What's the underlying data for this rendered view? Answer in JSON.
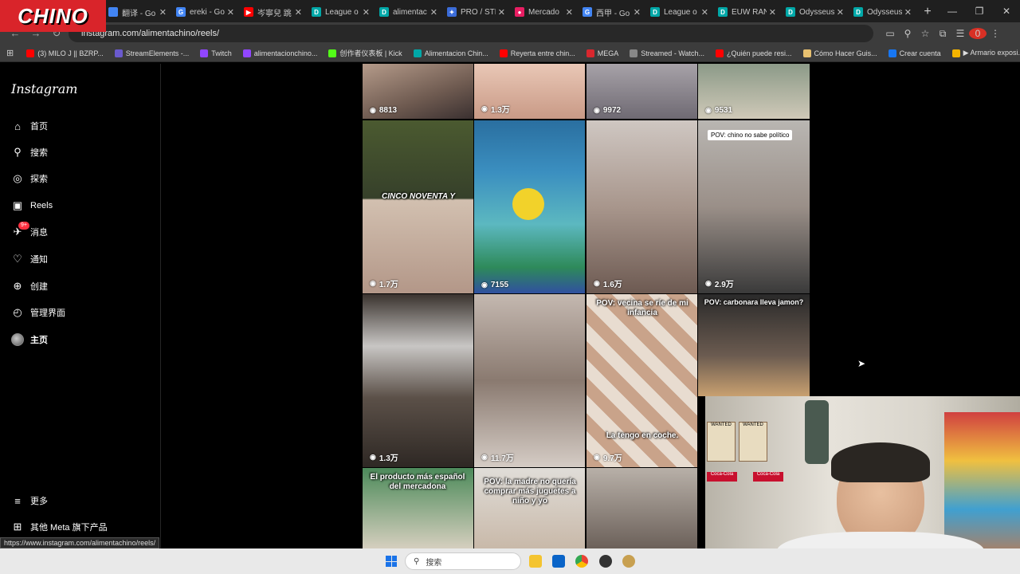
{
  "logo_overlay": "CHINO",
  "tabs": [
    {
      "title": "翻译 - Go",
      "color": "#4285f4",
      "glyph": ""
    },
    {
      "title": "ereki - Go",
      "color": "#4285f4",
      "glyph": "G"
    },
    {
      "title": "岑寧兒 跳",
      "color": "#ff0000",
      "glyph": "▶"
    },
    {
      "title": "League o",
      "color": "#00a8a8",
      "glyph": "D"
    },
    {
      "title": "alimentac",
      "color": "#00a8a8",
      "glyph": "D"
    },
    {
      "title": "PRO / STR",
      "color": "#3b6cd9",
      "glyph": "✦"
    },
    {
      "title": "Mercado",
      "color": "#e91e63",
      "glyph": "●"
    },
    {
      "title": "西甲 - Go",
      "color": "#4285f4",
      "glyph": "G"
    },
    {
      "title": "League o",
      "color": "#00a8a8",
      "glyph": "D"
    },
    {
      "title": "EUW RAN",
      "color": "#00a8a8",
      "glyph": "D"
    },
    {
      "title": "Odysseus",
      "color": "#00a8a8",
      "glyph": "D"
    },
    {
      "title": "Odysseus",
      "color": "#00a8a8",
      "glyph": "D"
    }
  ],
  "address": {
    "url": "instagram.com/alimentachino/reels/",
    "profile_badge": "0"
  },
  "bookmarks": [
    {
      "label": "(3) MILO J || BZRP...",
      "color": "#ff0000"
    },
    {
      "label": "StreamElements -...",
      "color": "#6a5acd"
    },
    {
      "label": "Twitch",
      "color": "#9146ff"
    },
    {
      "label": "alimentacionchino...",
      "color": "#9146ff"
    },
    {
      "label": "创作者仪表板 | Kick",
      "color": "#53fc18"
    },
    {
      "label": "Alimentacion Chin...",
      "color": "#00a8a8"
    },
    {
      "label": "Reyerta entre chin...",
      "color": "#ff0000"
    },
    {
      "label": "MEGA",
      "color": "#d9272e"
    },
    {
      "label": "Streamed - Watch...",
      "color": "#888888"
    },
    {
      "label": "¿Quién puede resi...",
      "color": "#ff0000"
    },
    {
      "label": "Cómo Hacer Guis...",
      "color": "#e8c170"
    },
    {
      "label": "Crear cuenta",
      "color": "#1877f2"
    },
    {
      "label": "▶ Armario exposi...",
      "color": "#f4b400"
    }
  ],
  "sidebar": {
    "brand": "Instagram",
    "items": [
      {
        "label": "首页",
        "icon": "home-icon",
        "glyph": "⌂"
      },
      {
        "label": "搜索",
        "icon": "search-icon",
        "glyph": "⚲"
      },
      {
        "label": "探索",
        "icon": "compass-icon",
        "glyph": "◎"
      },
      {
        "label": "Reels",
        "icon": "reels-icon",
        "glyph": "▣"
      },
      {
        "label": "消息",
        "icon": "messages-icon",
        "glyph": "✈",
        "badge": "9+"
      },
      {
        "label": "通知",
        "icon": "heart-icon",
        "glyph": "♡"
      },
      {
        "label": "创建",
        "icon": "create-icon",
        "glyph": "⊕"
      },
      {
        "label": "管理界面",
        "icon": "dashboard-icon",
        "glyph": "◴"
      },
      {
        "label": "主页",
        "icon": "avatar",
        "glyph": ""
      }
    ],
    "more": {
      "label": "更多",
      "glyph": "≡"
    },
    "meta": {
      "label": "其他 Meta 旗下产品",
      "glyph": "⊞"
    }
  },
  "reels": [
    {
      "views": "8813",
      "text": ""
    },
    {
      "views": "1.3万",
      "text": ""
    },
    {
      "views": "9972",
      "text": ""
    },
    {
      "views": "9531",
      "text": ""
    },
    {
      "views": "1.7万",
      "text": "CINCO NOVENTA Y"
    },
    {
      "views": "7155",
      "text": ""
    },
    {
      "views": "1.6万",
      "text": ""
    },
    {
      "views": "2.9万",
      "text": "POV: chino no sabe político"
    },
    {
      "views": "1.3万",
      "text": ""
    },
    {
      "views": "11.7万",
      "text": ""
    },
    {
      "views": "9.7万",
      "text": "POV: vecina se ríe de mi infancia"
    },
    {
      "views": "",
      "text": "POV: carbonara lleva jamon?"
    },
    {
      "views": "",
      "text": "El producto más español del mercadona"
    },
    {
      "views": "",
      "text": "POV: la madre no quería comprar más juguetes a niño y yo"
    },
    {
      "views": "",
      "text": ""
    },
    {
      "views": "",
      "text": ""
    }
  ],
  "reel_extra_text": "La tengo en coche.",
  "status_url": "https://www.instagram.com/alimentachino/reels/",
  "taskbar": {
    "search_placeholder": "搜索"
  },
  "webcam_signs": [
    "WANTED",
    "WANTED",
    "Coca-Cola",
    "Coca-Cola"
  ]
}
